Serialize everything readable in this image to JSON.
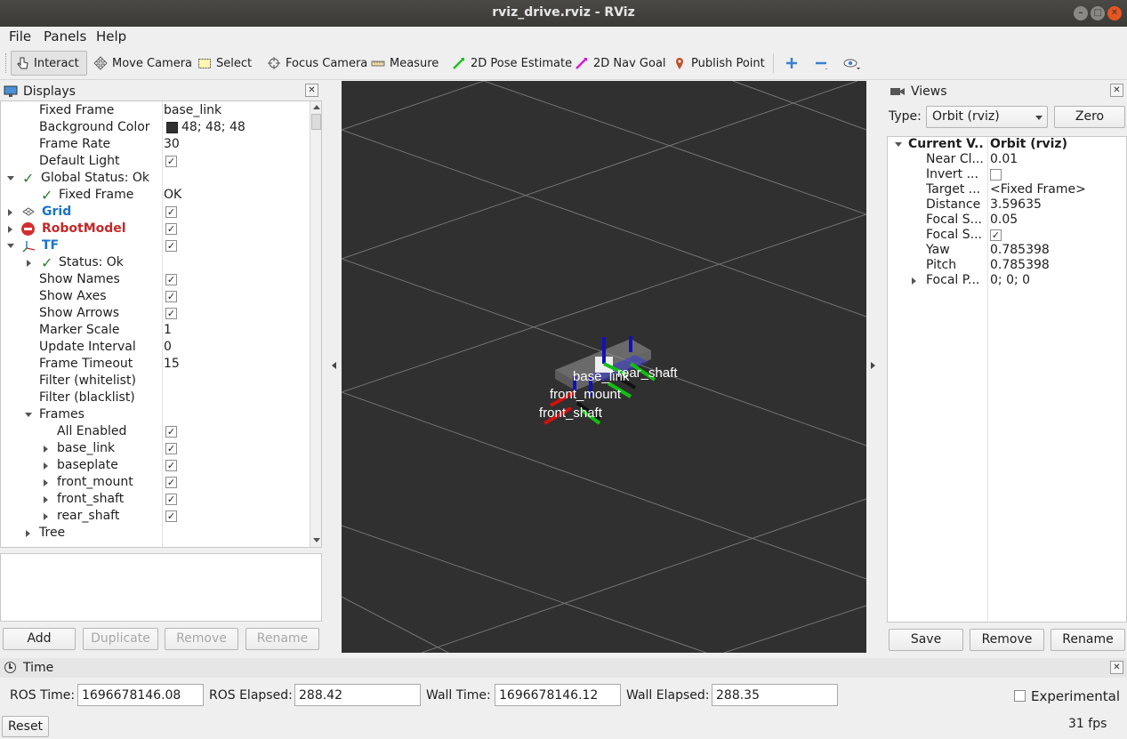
{
  "window": {
    "title": "rviz_drive.rviz - RViz"
  },
  "menu": {
    "file": "File",
    "panels": "Panels",
    "help": "Help"
  },
  "toolbar": {
    "interact": "Interact",
    "move_camera": "Move Camera",
    "select": "Select",
    "focus_camera": "Focus Camera",
    "measure": "Measure",
    "pose_estimate": "2D Pose Estimate",
    "nav_goal": "2D Nav Goal",
    "publish_point": "Publish Point"
  },
  "displays": {
    "title": "Displays",
    "rows": [
      {
        "name": "Fixed Frame",
        "value": "base_link"
      },
      {
        "name": "Background Color",
        "value": "48; 48; 48"
      },
      {
        "name": "Frame Rate",
        "value": "30"
      },
      {
        "name": "Default Light",
        "value": ""
      },
      {
        "name": "Global Status: Ok",
        "value": ""
      },
      {
        "name": "Fixed Frame",
        "value": "OK"
      },
      {
        "name": "Grid",
        "value": ""
      },
      {
        "name": "RobotModel",
        "value": ""
      },
      {
        "name": "TF",
        "value": ""
      },
      {
        "name": "Status: Ok",
        "value": ""
      },
      {
        "name": "Show Names",
        "value": ""
      },
      {
        "name": "Show Axes",
        "value": ""
      },
      {
        "name": "Show Arrows",
        "value": ""
      },
      {
        "name": "Marker Scale",
        "value": "1"
      },
      {
        "name": "Update Interval",
        "value": "0"
      },
      {
        "name": "Frame Timeout",
        "value": "15"
      },
      {
        "name": "Filter (whitelist)",
        "value": ""
      },
      {
        "name": "Filter (blacklist)",
        "value": ""
      },
      {
        "name": "Frames",
        "value": ""
      },
      {
        "name": "All Enabled",
        "value": ""
      },
      {
        "name": "base_link",
        "value": ""
      },
      {
        "name": "baseplate",
        "value": ""
      },
      {
        "name": "front_mount",
        "value": ""
      },
      {
        "name": "front_shaft",
        "value": ""
      },
      {
        "name": "rear_shaft",
        "value": ""
      },
      {
        "name": "Tree",
        "value": ""
      }
    ],
    "buttons": {
      "add": "Add",
      "duplicate": "Duplicate",
      "remove": "Remove",
      "rename": "Rename"
    }
  },
  "viewport": {
    "labels": {
      "base": "base_link",
      "rear": "rear_shaft",
      "mount": "front_mount",
      "shaft": "front_shaft"
    }
  },
  "views": {
    "title": "Views",
    "type_label": "Type:",
    "type_value": "Orbit (rviz)",
    "zero": "Zero",
    "rows": [
      {
        "name": "Current V...",
        "value": "Orbit (rviz)"
      },
      {
        "name": "Near Cl...",
        "value": "0.01"
      },
      {
        "name": "Invert ...",
        "value": ""
      },
      {
        "name": "Target ...",
        "value": "<Fixed Frame>"
      },
      {
        "name": "Distance",
        "value": "3.59635"
      },
      {
        "name": "Focal S...",
        "value": "0.05"
      },
      {
        "name": "Focal S...",
        "value": ""
      },
      {
        "name": "Yaw",
        "value": "0.785398"
      },
      {
        "name": "Pitch",
        "value": "0.785398"
      },
      {
        "name": "Focal P...",
        "value": "0; 0; 0"
      }
    ],
    "buttons": {
      "save": "Save",
      "remove": "Remove",
      "rename": "Rename"
    }
  },
  "time": {
    "title": "Time",
    "ros_time_label": "ROS Time:",
    "ros_time": "1696678146.08",
    "ros_elapsed_label": "ROS Elapsed:",
    "ros_elapsed": "288.42",
    "wall_time_label": "Wall Time:",
    "wall_time": "1696678146.12",
    "wall_elapsed_label": "Wall Elapsed:",
    "wall_elapsed": "288.35",
    "experimental": "Experimental",
    "reset": "Reset",
    "fps": "31 fps"
  },
  "colors": {
    "background": "#303030",
    "grid_status": "#1a73c7",
    "robotmodel_error": "#c62828",
    "ok_check": "#2e7d32"
  }
}
